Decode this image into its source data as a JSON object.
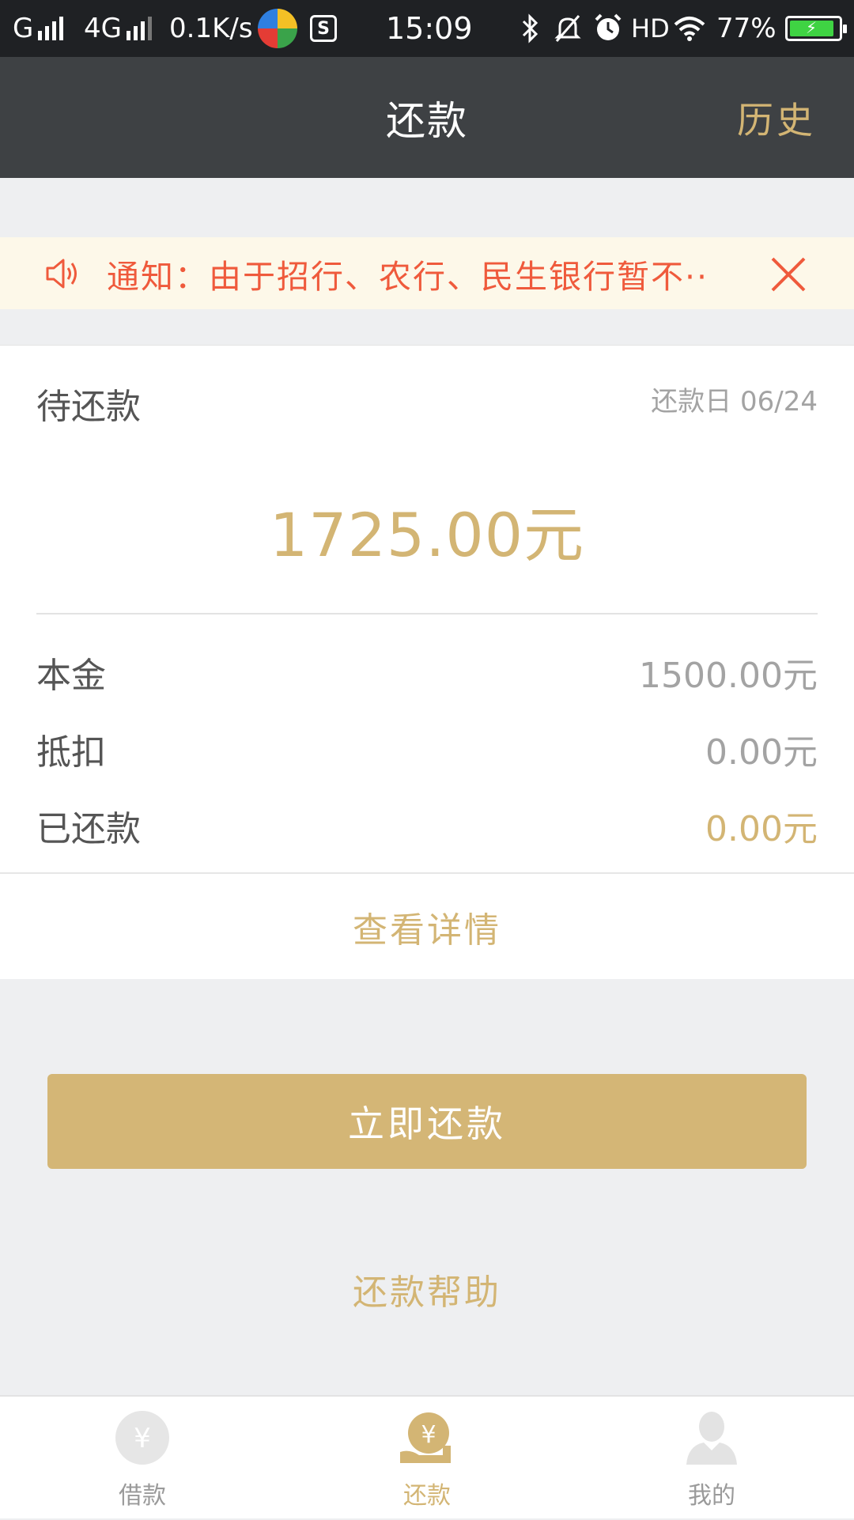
{
  "status_bar": {
    "carrier1": "G",
    "carrier2": "4G",
    "net_speed": "0.1K/s",
    "time": "15:09",
    "hd": "HD",
    "battery": "77%"
  },
  "header": {
    "title": "还款",
    "history_label": "历史"
  },
  "notice": {
    "text": "通知：由于招行、农行、民生银行暂不··",
    "icon": "speaker-icon",
    "close_icon": "close-icon"
  },
  "repayment": {
    "pending_label": "待还款",
    "due_date_label": "还款日",
    "due_date": "06/24",
    "amount": "1725.00元",
    "rows": [
      {
        "label": "本金",
        "value": "1500.00元"
      },
      {
        "label": "抵扣",
        "value": "0.00元"
      },
      {
        "label": "已还款",
        "value": "0.00元"
      }
    ],
    "details_label": "查看详情"
  },
  "actions": {
    "repay_now": "立即还款",
    "help": "还款帮助"
  },
  "bottom_nav": {
    "items": [
      {
        "label": "借款",
        "icon": "yen-coin-icon"
      },
      {
        "label": "还款",
        "icon": "yen-hand-icon",
        "active": true
      },
      {
        "label": "我的",
        "icon": "user-icon"
      }
    ]
  },
  "colors": {
    "gold": "#d3b574",
    "notice_red": "#ef5a3c",
    "header_bg": "#3e4144"
  }
}
